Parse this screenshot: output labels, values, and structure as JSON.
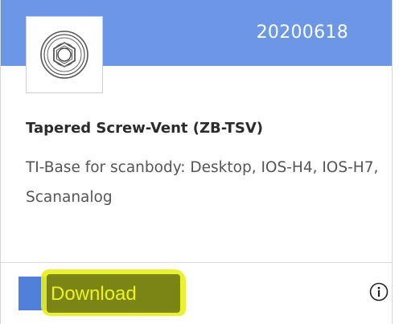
{
  "product": {
    "id_code": "20200618",
    "title": "Tapered Screw-Vent (ZB-TSV)",
    "description": "TI-Base for scanbody: Desktop, IOS-H4, IOS-H7, Scananalog",
    "thumbnail_icon": "implant-screw-icon"
  },
  "actions": {
    "download_label": "Download",
    "info_icon": "info-icon"
  },
  "colors": {
    "header": "#6b97e6",
    "button": "#4f7fd9",
    "highlight": "#e8ef1a"
  }
}
